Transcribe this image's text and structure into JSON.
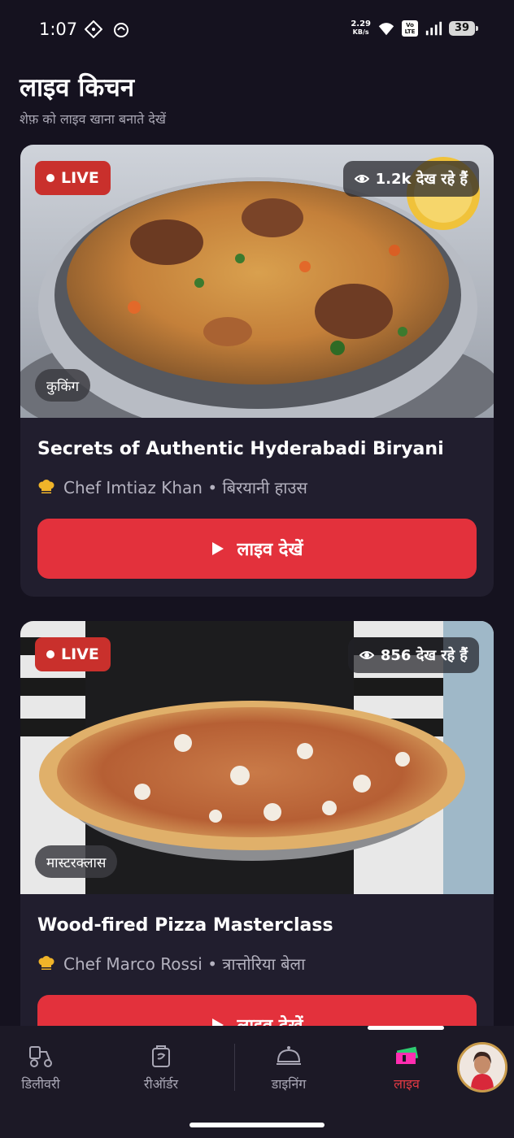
{
  "status_bar": {
    "time": "1:07",
    "net_speed_value": "2.29",
    "net_speed_unit": "KB/s",
    "volte": "Vo LTE",
    "battery": "39"
  },
  "header": {
    "title": "लाइव किचन",
    "subtitle": "शेफ़ को लाइव खाना बनाते देखें"
  },
  "streams": [
    {
      "live_label": "LIVE",
      "viewers": "1.2k देख रहे हैं",
      "category": "कुकिंग",
      "title": "Secrets of Authentic Hyderabadi Biryani",
      "chef_line": "Chef Imtiaz Khan • बिरयानी हाउस",
      "button_label": "लाइव देखें"
    },
    {
      "live_label": "LIVE",
      "viewers": "856 देख रहे हैं",
      "category": "मास्टरक्लास",
      "title": "Wood-fired Pizza Masterclass",
      "chef_line": "Chef Marco Rossi • त्रात्तोरिया बेला",
      "button_label": "लाइव देखें"
    }
  ],
  "bottom_nav": {
    "items": [
      {
        "label": "डिलीवरी",
        "icon": "delivery-scooter-icon"
      },
      {
        "label": "रीऑर्डर",
        "icon": "reorder-bag-icon"
      },
      {
        "label": "डाइनिंग",
        "icon": "dining-cloche-icon"
      },
      {
        "label": "लाइव",
        "icon": "live-ticket-icon"
      }
    ],
    "active": "लाइव"
  },
  "colors": {
    "background": "#15121f",
    "card": "#211e2e",
    "accent": "#e3313c",
    "live_badge": "#c9302c",
    "muted_text": "#a8a6b3"
  }
}
